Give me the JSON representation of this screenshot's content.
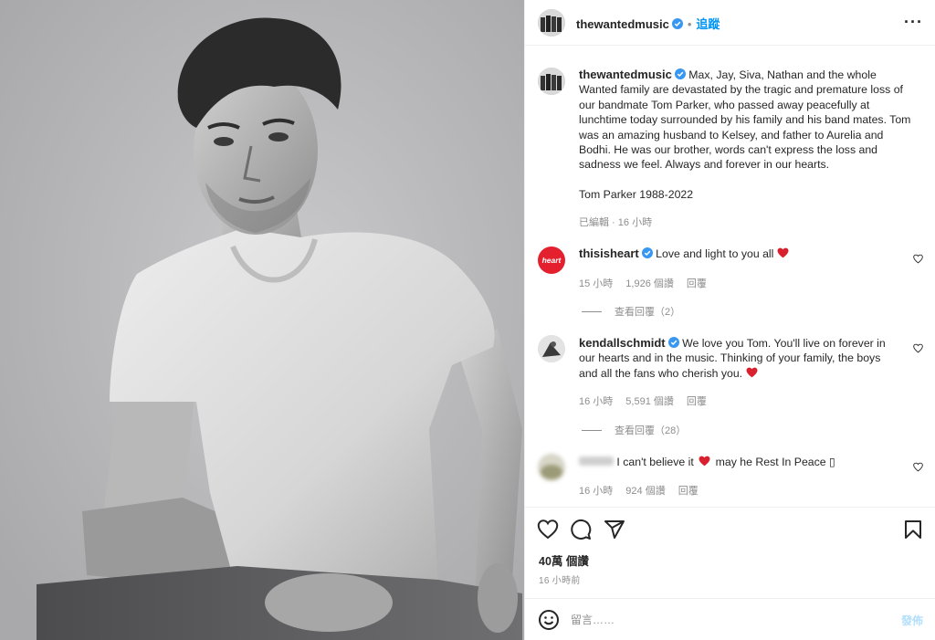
{
  "post": {
    "account": "thewantedmusic",
    "follow_label": "追蹤",
    "more_label": "···",
    "caption": "Max, Jay, Siva, Nathan and the whole Wanted family are devastated by the tragic and premature loss of our bandmate Tom Parker, who passed away peacefully at lunchtime today surrounded by his family and his band mates. Tom was an amazing husband to Kelsey, and father to Aurelia and Bodhi. He was our brother, words can't express the loss and sadness we feel. Always and forever in our hearts.",
    "caption_sign": "Tom Parker 1988-2022",
    "caption_meta": "已編輯 · 16 小時",
    "likes": "40萬 個讚",
    "time_ago": "16 小時前"
  },
  "comments": [
    {
      "user": "thisisheart",
      "avatar_text": "heart",
      "text": "Love and light to you all",
      "time": "15 小時",
      "likes": "1,926 個讚",
      "reply": "回覆",
      "view_replies": "查看回覆（2）"
    },
    {
      "user": "kendallschmidt",
      "text": "We love you Tom. You'll live on forever in our hearts and in the music. Thinking of your family, the boys and all the fans who cherish you.",
      "time": "16 小時",
      "likes": "5,591 個讚",
      "reply": "回覆",
      "view_replies": "查看回覆（28）"
    },
    {
      "user": "",
      "text_a": "I can't believe it",
      "text_b": "may he Rest In Peace",
      "trailing_glyph": "▯",
      "time": "16 小時",
      "likes": "924 個讚",
      "reply": "回覆"
    }
  ],
  "composer": {
    "placeholder": "留言……",
    "post_label": "發佈"
  },
  "colors": {
    "accent": "#0095f6",
    "verified": "#3897f0",
    "heart": "#ed4956",
    "brand_heart_bg": "#e4202e"
  },
  "icons": [
    "verified-badge-icon",
    "more-options-icon",
    "like-heart-icon",
    "comment-icon",
    "share-icon",
    "bookmark-icon",
    "emoji-icon",
    "red-heart-emoji-icon"
  ]
}
